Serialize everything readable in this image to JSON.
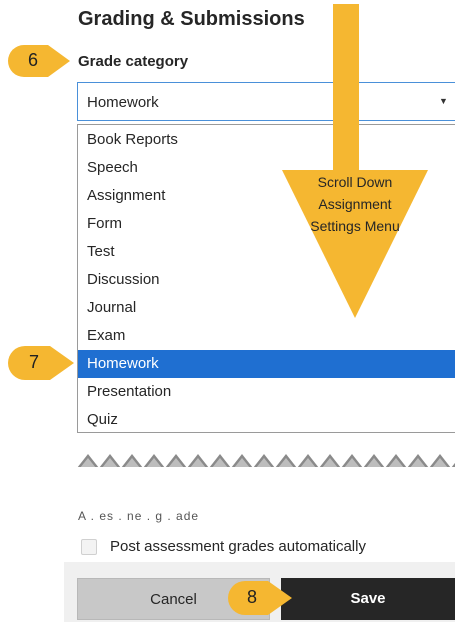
{
  "section": {
    "title": "Grading & Submissions"
  },
  "grade_category": {
    "label": "Grade category",
    "value": "Homework",
    "options": [
      "Book Reports",
      "Speech",
      "Assignment",
      "Form",
      "Test",
      "Discussion",
      "Journal",
      "Exam",
      "Homework",
      "Presentation",
      "Quiz"
    ],
    "selected_index": 8
  },
  "obscured_label": "A . es . ne . g . ade",
  "checkbox": {
    "label": "Post assessment grades automatically",
    "checked": false
  },
  "buttons": {
    "cancel": "Cancel",
    "save": "Save"
  },
  "annotations": {
    "callouts": [
      "6",
      "7",
      "8"
    ],
    "arrow_text": [
      "Scroll Down",
      "Assignment",
      "Settings Menu"
    ]
  },
  "colors": {
    "accent": "#1f6fd1",
    "callout": "#f5b731",
    "save_button": "#262626",
    "cancel_button": "#c8c8c8"
  },
  "icons": {
    "select_caret": "caret-down-icon",
    "callout": "callout-marker-icon",
    "arrow": "arrow-down-icon"
  }
}
